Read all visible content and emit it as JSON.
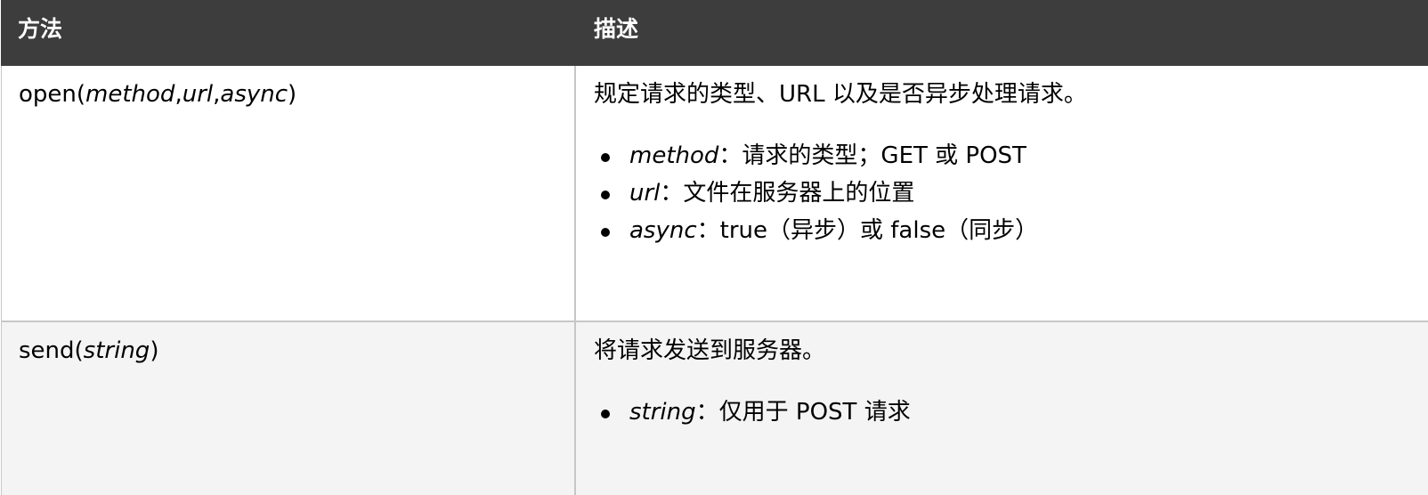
{
  "header": {
    "col_method": "方法",
    "col_description": "描述"
  },
  "rows": [
    {
      "method_name": "open(",
      "method_params": [
        "method",
        ",",
        "url",
        ",",
        "async"
      ],
      "method_close": ")",
      "description": "规定请求的类型、URL 以及是否异步处理请求。",
      "params": [
        {
          "name": "method",
          "text": "：请求的类型；GET 或 POST"
        },
        {
          "name": "url",
          "text": "：文件在服务器上的位置"
        },
        {
          "name": "async",
          "text": "：true（异步）或 false（同步）"
        }
      ]
    },
    {
      "method_name": "send(",
      "method_params": [
        "string"
      ],
      "method_close": ")",
      "description": "将请求发送到服务器。",
      "params": [
        {
          "name": "string",
          "text": "：仅用于 POST 请求"
        }
      ]
    }
  ],
  "colors": {
    "header_bg": "#3d3d3d",
    "header_text": "#ffffff",
    "row_alt_bg": "#f4f4f4",
    "border": "#c6c6c6"
  }
}
